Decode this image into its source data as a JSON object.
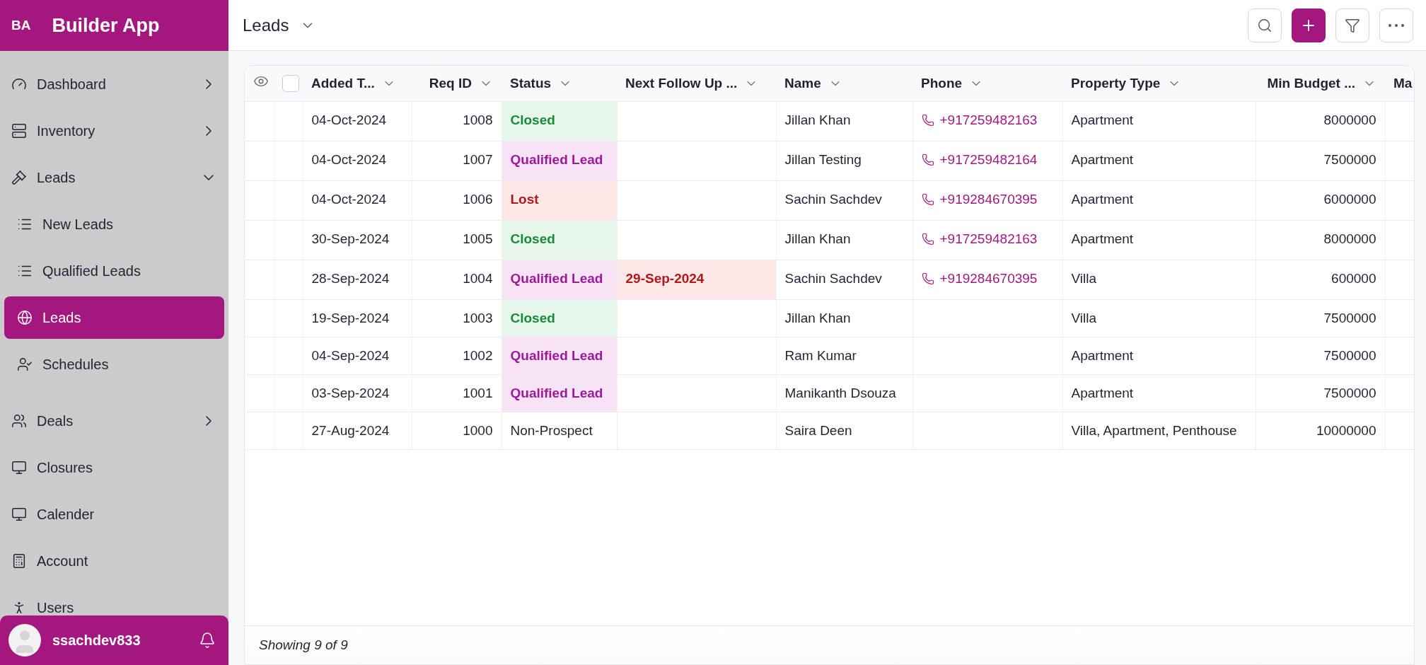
{
  "brand": {
    "initials": "BA",
    "name": "Builder App"
  },
  "sidebar": {
    "items": [
      {
        "label": "Dashboard",
        "expanded": false,
        "selected": false
      },
      {
        "label": "Inventory",
        "expanded": false,
        "selected": false
      },
      {
        "label": "Leads",
        "expanded": true,
        "selected": false,
        "children": [
          {
            "label": "New Leads",
            "selected": false
          },
          {
            "label": "Qualified Leads",
            "selected": false
          },
          {
            "label": "Leads",
            "selected": true
          },
          {
            "label": "Schedules",
            "selected": false
          }
        ]
      },
      {
        "label": "Deals",
        "expanded": false,
        "selected": false
      },
      {
        "label": "Closures",
        "selected": false
      },
      {
        "label": "Calender",
        "selected": false
      },
      {
        "label": "Account",
        "selected": false
      },
      {
        "label": "Users",
        "selected": false
      }
    ]
  },
  "user": {
    "name": "ssachdev833"
  },
  "header": {
    "title": "Leads"
  },
  "table": {
    "select_all": {
      "checked": false
    },
    "columns": [
      {
        "label": "Added T..."
      },
      {
        "label": "Req ID"
      },
      {
        "label": "Status"
      },
      {
        "label": "Next Follow Up ..."
      },
      {
        "label": "Name"
      },
      {
        "label": "Phone"
      },
      {
        "label": "Property Type"
      },
      {
        "label": "Min Budget ..."
      },
      {
        "label": "Ma"
      }
    ],
    "rows": [
      {
        "added": "04-Oct-2024",
        "req_id": "1008",
        "status": {
          "label": "Closed",
          "kind": "closed"
        },
        "follow_up": null,
        "name": "Jillan Khan",
        "phone": "+917259482163",
        "property_type": "Apartment",
        "min_budget": "8000000"
      },
      {
        "added": "04-Oct-2024",
        "req_id": "1007",
        "status": {
          "label": "Qualified Lead",
          "kind": "qualified"
        },
        "follow_up": null,
        "name": "Jillan Testing",
        "phone": "+917259482164",
        "property_type": "Apartment",
        "min_budget": "7500000"
      },
      {
        "added": "04-Oct-2024",
        "req_id": "1006",
        "status": {
          "label": "Lost",
          "kind": "lost"
        },
        "follow_up": null,
        "name": "Sachin Sachdev",
        "phone": "+919284670395",
        "property_type": "Apartment",
        "min_budget": "6000000"
      },
      {
        "added": "30-Sep-2024",
        "req_id": "1005",
        "status": {
          "label": "Closed",
          "kind": "closed"
        },
        "follow_up": null,
        "name": "Jillan Khan",
        "phone": "+917259482163",
        "property_type": "Apartment",
        "min_budget": "8000000"
      },
      {
        "added": "28-Sep-2024",
        "req_id": "1004",
        "status": {
          "label": "Qualified Lead",
          "kind": "qualified"
        },
        "follow_up": {
          "date": "29-Sep-2024",
          "overdue": true
        },
        "name": "Sachin Sachdev",
        "phone": "+919284670395",
        "property_type": "Villa",
        "min_budget": "600000"
      },
      {
        "added": "19-Sep-2024",
        "req_id": "1003",
        "status": {
          "label": "Closed",
          "kind": "closed"
        },
        "follow_up": null,
        "name": "Jillan Khan",
        "phone": null,
        "property_type": "Villa",
        "min_budget": "7500000"
      },
      {
        "added": "04-Sep-2024",
        "req_id": "1002",
        "status": {
          "label": "Qualified Lead",
          "kind": "qualified"
        },
        "follow_up": null,
        "name": "Ram Kumar",
        "phone": null,
        "property_type": "Apartment",
        "min_budget": "7500000"
      },
      {
        "added": "03-Sep-2024",
        "req_id": "1001",
        "status": {
          "label": "Qualified Lead",
          "kind": "qualified"
        },
        "follow_up": null,
        "name": "Manikanth Dsouza",
        "phone": null,
        "property_type": "Apartment",
        "min_budget": "7500000"
      },
      {
        "added": "27-Aug-2024",
        "req_id": "1000",
        "status": {
          "label": "Non-Prospect",
          "kind": "plain"
        },
        "follow_up": null,
        "name": "Saira Deen",
        "phone": null,
        "property_type": "Villa, Apartment, Penthouse",
        "min_budget": "10000000"
      }
    ],
    "footer": "Showing 9 of 9"
  }
}
